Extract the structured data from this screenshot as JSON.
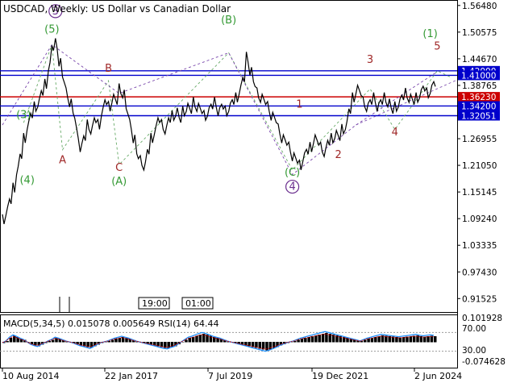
{
  "title": "USDCAD, Weekly:  US Dollar vs Canadian Dollar",
  "colors": {
    "background": "#ffffff",
    "price_line": "#000000",
    "blue_level": "#0000cc",
    "red_level": "#cc0000",
    "green_wave": "#339933",
    "purple_wave": "#6a2e8e",
    "red_wave": "#a02828",
    "dashed_green": "#66aa66",
    "dashed_purple": "#7744aa",
    "rsi_line": "#1e90ff",
    "macd_hist": "#000000",
    "macd_signal": "#cc0000"
  },
  "chart_data": [
    {
      "type": "line",
      "title": "USDCAD, Weekly:  US Dollar vs Canadian Dollar",
      "xlabel": "",
      "ylabel": "",
      "ylim": [
        0.889,
        1.568
      ],
      "x_ticks": [
        "10 Aug 2014",
        "22 Jan 2017",
        "7 Jul 2019",
        "19 Dec 2021",
        "2 Jun 2024"
      ],
      "y_ticks": [
        "1.56480",
        "1.50575",
        "1.44670",
        "1.38765",
        "1.32860",
        "1.26955",
        "1.21050",
        "1.15145",
        "1.09240",
        "1.03335",
        "0.97430",
        "0.91525"
      ],
      "time_markers": [
        "19:00",
        "01:00"
      ],
      "series": [
        {
          "values": [
            1.09,
            1.11,
            1.13,
            1.16,
            1.2,
            1.23,
            1.27,
            1.3,
            1.32,
            1.34,
            1.35,
            1.37,
            1.39,
            1.43,
            1.47,
            1.48,
            1.44,
            1.4,
            1.37,
            1.35,
            1.32,
            1.28,
            1.25,
            1.27,
            1.3,
            1.29,
            1.31,
            1.3,
            1.33,
            1.35,
            1.34,
            1.36,
            1.35,
            1.38,
            1.37,
            1.33,
            1.3,
            1.27,
            1.23,
            1.22,
            1.21,
            1.24,
            1.27,
            1.29,
            1.31,
            1.3,
            1.29,
            1.31,
            1.32,
            1.33,
            1.31,
            1.33,
            1.34,
            1.33,
            1.35,
            1.34,
            1.33,
            1.32,
            1.33,
            1.34,
            1.35,
            1.33,
            1.34,
            1.33,
            1.34,
            1.35,
            1.36,
            1.38,
            1.4,
            1.45,
            1.42,
            1.39,
            1.37,
            1.36,
            1.35,
            1.34,
            1.32,
            1.31,
            1.29,
            1.27,
            1.26,
            1.25,
            1.23,
            1.22,
            1.21,
            1.23,
            1.24,
            1.25,
            1.27,
            1.26,
            1.25,
            1.24,
            1.26,
            1.27,
            1.28,
            1.27,
            1.29,
            1.3,
            1.33,
            1.36,
            1.38,
            1.37,
            1.35,
            1.34,
            1.35,
            1.36,
            1.34,
            1.35,
            1.36,
            1.35,
            1.33,
            1.34,
            1.35,
            1.36,
            1.37,
            1.36,
            1.35,
            1.36,
            1.37,
            1.38,
            1.37,
            1.38,
            1.39
          ]
        }
      ],
      "horizontal_levels": [
        {
          "label": "1.42000",
          "value": 1.42,
          "color": "blue"
        },
        {
          "label": "1.41000",
          "value": 1.41,
          "color": "blue"
        },
        {
          "label": "1.36230",
          "value": 1.3623,
          "color": "red"
        },
        {
          "label": "1.34200",
          "value": 1.342,
          "color": "blue"
        },
        {
          "label": "1.32051",
          "value": 1.32051,
          "color": "blue"
        }
      ],
      "wave_labels": [
        {
          "text": "3",
          "style": "circled-purple",
          "x_index": 15,
          "y": 1.545
        },
        {
          "text": "(5)",
          "style": "green",
          "x_index": 14,
          "y": 1.505
        },
        {
          "text": "(3)",
          "style": "green",
          "x_index": 6,
          "y": 1.315
        },
        {
          "text": "(4)",
          "style": "green",
          "x_index": 7,
          "y": 1.17
        },
        {
          "text": "A",
          "style": "red",
          "x_index": 17,
          "y": 1.215
        },
        {
          "text": "B",
          "style": "red",
          "x_index": 30,
          "y": 1.418
        },
        {
          "text": "C",
          "style": "red",
          "x_index": 33,
          "y": 1.198
        },
        {
          "text": "(A)",
          "style": "green",
          "x_index": 33,
          "y": 1.168
        },
        {
          "text": "(B)",
          "style": "green",
          "x_index": 64,
          "y": 1.525
        },
        {
          "text": "1",
          "style": "red",
          "x_index": 84,
          "y": 1.338
        },
        {
          "text": "(C)",
          "style": "green",
          "x_index": 82,
          "y": 1.187
        },
        {
          "text": "4",
          "style": "circled-purple",
          "x_index": 82,
          "y": 1.156
        },
        {
          "text": "2",
          "style": "red",
          "x_index": 95,
          "y": 1.227
        },
        {
          "text": "3",
          "style": "red",
          "x_index": 104,
          "y": 1.438
        },
        {
          "text": "4",
          "style": "red",
          "x_index": 111,
          "y": 1.277
        },
        {
          "text": "(1)",
          "style": "green",
          "x_index": 121,
          "y": 1.495
        },
        {
          "text": "5",
          "style": "red",
          "x_index": 123,
          "y": 1.467
        }
      ]
    },
    {
      "type": "line",
      "title": "MACD(5,34,5) 0.015078 0.005649 RSI(14) 64.44",
      "xlabel": "",
      "ylabel": "",
      "ylim": [
        -0.085,
        0.112
      ],
      "y_ticks": [
        "0.101928",
        "70.00",
        "30.00",
        "-0.074628"
      ],
      "series": [
        {
          "name": "RSI(14)",
          "values": [
            48,
            52,
            60,
            65,
            62,
            58,
            55,
            50,
            45,
            42,
            40,
            44,
            48,
            52,
            55,
            60,
            58,
            55,
            52,
            50,
            48,
            45,
            42,
            40,
            38,
            36,
            40,
            44,
            48,
            50,
            52,
            55,
            58,
            60,
            62,
            60,
            58,
            55,
            52,
            50,
            48,
            46,
            44,
            42,
            40,
            38,
            36,
            35,
            38,
            40,
            45,
            50,
            55,
            60,
            62,
            65,
            68,
            70,
            68,
            65,
            62,
            60,
            58,
            55,
            52,
            50,
            48,
            46,
            44,
            42,
            40,
            38,
            36,
            34,
            32,
            30,
            32,
            35,
            38,
            42,
            45,
            48,
            50,
            52,
            55,
            58,
            60,
            62,
            64,
            66,
            68,
            70,
            72,
            70,
            68,
            66,
            64,
            62,
            60,
            58,
            56,
            54,
            52,
            55,
            58,
            60,
            62,
            64,
            66,
            65,
            64,
            63,
            62,
            61,
            62,
            63,
            64,
            65,
            66,
            64,
            63,
            64,
            65,
            64
          ]
        }
      ]
    }
  ]
}
